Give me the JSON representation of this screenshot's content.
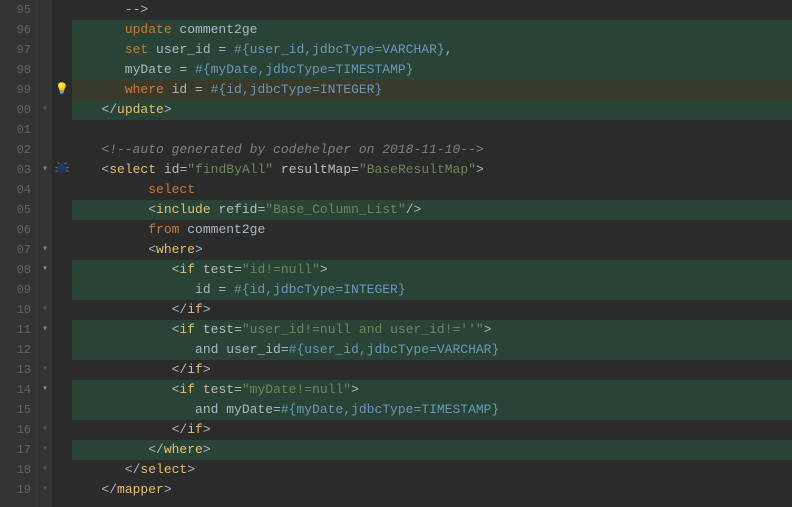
{
  "editor": {
    "lines": [
      {
        "num": "95",
        "fold": "",
        "icon": "",
        "highlight": "",
        "tokens": [
          {
            "t": "plain",
            "v": "      -->"
          }
        ]
      },
      {
        "num": "96",
        "fold": "",
        "icon": "",
        "highlight": "green-bg",
        "tokens": [
          {
            "t": "plain",
            "v": "      "
          },
          {
            "t": "kw",
            "v": "update"
          },
          {
            "t": "plain",
            "v": " comment2ge"
          }
        ]
      },
      {
        "num": "97",
        "fold": "",
        "icon": "",
        "highlight": "green-bg",
        "tokens": [
          {
            "t": "plain",
            "v": "      "
          },
          {
            "t": "kw",
            "v": "set"
          },
          {
            "t": "plain",
            "v": " user_id = "
          },
          {
            "t": "var",
            "v": "#{user_id,jdbcType=VARCHAR}"
          },
          {
            "t": "plain",
            "v": ","
          }
        ]
      },
      {
        "num": "98",
        "fold": "",
        "icon": "",
        "highlight": "green-bg",
        "tokens": [
          {
            "t": "plain",
            "v": "      myDate = "
          },
          {
            "t": "var",
            "v": "#{myDate,jdbcType=TIMESTAMP}"
          }
        ]
      },
      {
        "num": "99",
        "fold": "",
        "icon": "bulb",
        "highlight": "highlighted",
        "tokens": [
          {
            "t": "plain",
            "v": "      "
          },
          {
            "t": "kw",
            "v": "where"
          },
          {
            "t": "plain",
            "v": " id = "
          },
          {
            "t": "var",
            "v": "#{id,jdbcType=INTEGER}"
          }
        ]
      },
      {
        "num": "00",
        "fold": "close",
        "icon": "",
        "highlight": "green-bg",
        "tokens": [
          {
            "t": "plain",
            "v": "   </"
          },
          {
            "t": "tag",
            "v": "update"
          },
          {
            "t": "plain",
            "v": ">"
          }
        ]
      },
      {
        "num": "01",
        "fold": "",
        "icon": "",
        "highlight": "",
        "tokens": []
      },
      {
        "num": "02",
        "fold": "",
        "icon": "",
        "highlight": "",
        "tokens": [
          {
            "t": "plain",
            "v": "   "
          },
          {
            "t": "comment",
            "v": "<!--auto generated by codehelper on 2018-11-10-->"
          }
        ]
      },
      {
        "num": "03",
        "fold": "open",
        "icon": "bug",
        "highlight": "",
        "tokens": [
          {
            "t": "plain",
            "v": "   <"
          },
          {
            "t": "tag",
            "v": "select"
          },
          {
            "t": "plain",
            "v": " "
          },
          {
            "t": "attr",
            "v": "id"
          },
          {
            "t": "plain",
            "v": "="
          },
          {
            "t": "attr-val",
            "v": "\"findByAll\""
          },
          {
            "t": "plain",
            "v": " "
          },
          {
            "t": "attr",
            "v": "resultMap"
          },
          {
            "t": "plain",
            "v": "="
          },
          {
            "t": "attr-val",
            "v": "\"BaseResultMap\""
          },
          {
            "t": "plain",
            "v": ">"
          }
        ]
      },
      {
        "num": "04",
        "fold": "",
        "icon": "",
        "highlight": "",
        "tokens": [
          {
            "t": "plain",
            "v": "         "
          },
          {
            "t": "kw",
            "v": "select"
          }
        ]
      },
      {
        "num": "05",
        "fold": "",
        "icon": "",
        "highlight": "green-bg",
        "tokens": [
          {
            "t": "plain",
            "v": "         <"
          },
          {
            "t": "tag",
            "v": "include"
          },
          {
            "t": "plain",
            "v": " "
          },
          {
            "t": "attr",
            "v": "refid"
          },
          {
            "t": "plain",
            "v": "="
          },
          {
            "t": "attr-val",
            "v": "\"Base_Column_List\""
          },
          {
            "t": "plain",
            "v": "/>"
          }
        ]
      },
      {
        "num": "06",
        "fold": "",
        "icon": "",
        "highlight": "",
        "tokens": [
          {
            "t": "plain",
            "v": "         "
          },
          {
            "t": "kw",
            "v": "from"
          },
          {
            "t": "plain",
            "v": " comment2ge"
          }
        ]
      },
      {
        "num": "07",
        "fold": "open",
        "icon": "",
        "highlight": "",
        "tokens": [
          {
            "t": "plain",
            "v": "         <"
          },
          {
            "t": "tag",
            "v": "where"
          },
          {
            "t": "plain",
            "v": ">"
          }
        ]
      },
      {
        "num": "08",
        "fold": "open",
        "icon": "",
        "highlight": "green-bg",
        "tokens": [
          {
            "t": "plain",
            "v": "            <"
          },
          {
            "t": "tag",
            "v": "if"
          },
          {
            "t": "plain",
            "v": " "
          },
          {
            "t": "attr",
            "v": "test"
          },
          {
            "t": "plain",
            "v": "="
          },
          {
            "t": "attr-val",
            "v": "\"id!=null\""
          },
          {
            "t": "plain",
            "v": ">"
          }
        ]
      },
      {
        "num": "09",
        "fold": "",
        "icon": "",
        "highlight": "green-bg",
        "tokens": [
          {
            "t": "plain",
            "v": "               id = "
          },
          {
            "t": "var",
            "v": "#{id,jdbcType=INTEGER}"
          }
        ]
      },
      {
        "num": "10",
        "fold": "close",
        "icon": "",
        "highlight": "",
        "tokens": [
          {
            "t": "plain",
            "v": "            </"
          },
          {
            "t": "tag",
            "v": "if"
          },
          {
            "t": "plain",
            "v": ">"
          }
        ]
      },
      {
        "num": "11",
        "fold": "open",
        "icon": "",
        "highlight": "green-bg",
        "tokens": [
          {
            "t": "plain",
            "v": "            <"
          },
          {
            "t": "tag",
            "v": "if"
          },
          {
            "t": "plain",
            "v": " "
          },
          {
            "t": "attr",
            "v": "test"
          },
          {
            "t": "plain",
            "v": "="
          },
          {
            "t": "attr-val",
            "v": "\"user_id!=null and user_id!=''\""
          },
          {
            "t": "plain",
            "v": ">"
          }
        ]
      },
      {
        "num": "12",
        "fold": "",
        "icon": "",
        "highlight": "green-bg",
        "tokens": [
          {
            "t": "plain",
            "v": "               and user_id="
          },
          {
            "t": "var",
            "v": "#{user_id,jdbcType=VARCHAR}"
          }
        ]
      },
      {
        "num": "13",
        "fold": "close",
        "icon": "",
        "highlight": "",
        "tokens": [
          {
            "t": "plain",
            "v": "            </"
          },
          {
            "t": "tag",
            "v": "if"
          },
          {
            "t": "plain",
            "v": ">"
          }
        ]
      },
      {
        "num": "14",
        "fold": "open",
        "icon": "",
        "highlight": "green-bg",
        "tokens": [
          {
            "t": "plain",
            "v": "            <"
          },
          {
            "t": "tag",
            "v": "if"
          },
          {
            "t": "plain",
            "v": " "
          },
          {
            "t": "attr",
            "v": "test"
          },
          {
            "t": "plain",
            "v": "="
          },
          {
            "t": "attr-val",
            "v": "\"myDate!=null\""
          },
          {
            "t": "plain",
            "v": ">"
          }
        ]
      },
      {
        "num": "15",
        "fold": "",
        "icon": "",
        "highlight": "green-bg",
        "tokens": [
          {
            "t": "plain",
            "v": "               and myDate="
          },
          {
            "t": "var",
            "v": "#{myDate,jdbcType=TIMESTAMP}"
          }
        ]
      },
      {
        "num": "16",
        "fold": "close",
        "icon": "",
        "highlight": "",
        "tokens": [
          {
            "t": "plain",
            "v": "            </"
          },
          {
            "t": "tag",
            "v": "if"
          },
          {
            "t": "plain",
            "v": ">"
          }
        ]
      },
      {
        "num": "17",
        "fold": "close",
        "icon": "",
        "highlight": "green-bg",
        "tokens": [
          {
            "t": "plain",
            "v": "         </"
          },
          {
            "t": "tag",
            "v": "where"
          },
          {
            "t": "plain",
            "v": ">"
          }
        ]
      },
      {
        "num": "18",
        "fold": "close",
        "icon": "",
        "highlight": "",
        "tokens": [
          {
            "t": "plain",
            "v": "      </"
          },
          {
            "t": "tag",
            "v": "select"
          },
          {
            "t": "plain",
            "v": ">"
          }
        ]
      },
      {
        "num": "19",
        "fold": "close",
        "icon": "",
        "highlight": "",
        "tokens": [
          {
            "t": "plain",
            "v": "   </"
          },
          {
            "t": "tag",
            "v": "mapper"
          },
          {
            "t": "plain",
            "v": ">"
          }
        ]
      }
    ]
  }
}
